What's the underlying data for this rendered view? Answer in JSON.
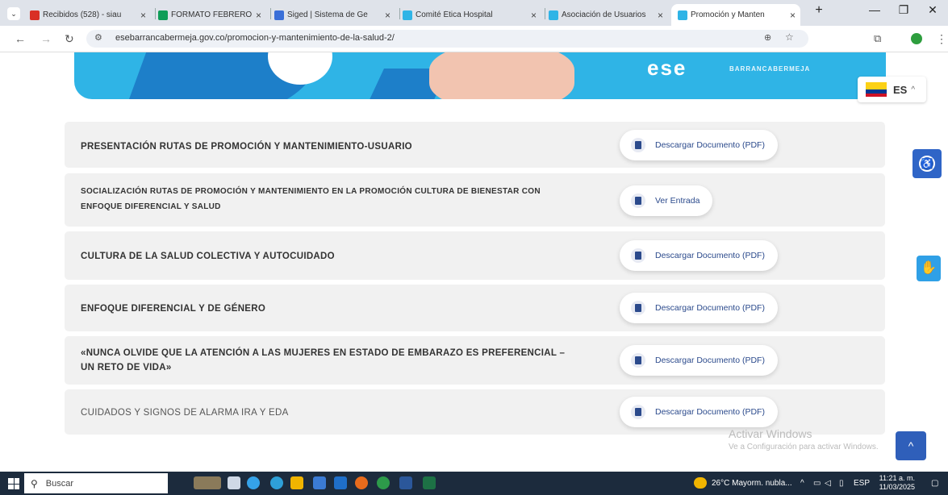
{
  "browser": {
    "tabs": [
      {
        "label": "Recibidos (528) - siau",
        "icon": "gmail-icon",
        "color": "#d93025"
      },
      {
        "label": "FORMATO FEBRERO",
        "icon": "sheets-icon",
        "color": "#0f9d58"
      },
      {
        "label": "Siged | Sistema de Ge",
        "icon": "siged-icon",
        "color": "#3a6fd8"
      },
      {
        "label": "Comité Ética Hospital",
        "icon": "ese-icon",
        "color": "#2fb4e6"
      },
      {
        "label": "Asociación de Usuarios",
        "icon": "ese-icon",
        "color": "#2fb4e6"
      },
      {
        "label": "Promoción y Manten",
        "icon": "ese-icon",
        "color": "#2fb4e6",
        "active": true
      }
    ],
    "tab_close": "×",
    "new_tab": "+",
    "tab_dropdown": "⌄",
    "window_controls": {
      "minimize": "—",
      "maximize": "❐",
      "close": "✕"
    },
    "url": "esebarrancabermeja.gov.co/promocion-y-mantenimiento-de-la-salud-2/"
  },
  "header": {
    "logo_text": "ese",
    "brand_text": "BARRANCABERMEJA",
    "language": {
      "code": "ES",
      "chevron": "^"
    }
  },
  "rows": [
    {
      "title": "PRESENTACIÓN RUTAS DE PROMOCIÓN Y MANTENIMIENTO-USUARIO",
      "button": "Descargar Documento (PDF)"
    },
    {
      "title": "SOCIALIZACIÓN RUTAS DE PROMOCIÓN Y MANTENIMIENTO EN LA PROMOCIÓN CULTURA DE BIENESTAR CON ENFOQUE DIFERENCIAL Y SALUD",
      "button": "Ver Entrada"
    },
    {
      "title": "CULTURA DE LA SALUD COLECTIVA Y AUTOCUIDADO",
      "button": "Descargar Documento (PDF)"
    },
    {
      "title": "ENFOQUE DIFERENCIAL Y DE GÉNERO",
      "button": "Descargar Documento (PDF)"
    },
    {
      "title": "«NUNCA OLVIDE QUE LA ATENCIÓN A LAS MUJERES EN ESTADO DE EMBARAZO ES PREFERENCIAL – UN RETO DE VIDA»",
      "button": "Descargar Documento (PDF)"
    },
    {
      "title": "CUIDADOS Y SIGNOS DE ALARMA IRA Y EDA",
      "button": "Descargar Documento (PDF)"
    }
  ],
  "watermark": {
    "line1": "Activar Windows",
    "line2": "Ve a Configuración para activar Windows."
  },
  "taskbar": {
    "search_placeholder": "Buscar",
    "weather": "26°C  Mayorm. nubla...",
    "language": "ESP",
    "time": "11:21 a. m.",
    "date": "11/03/2025"
  },
  "colors": {
    "banner": "#2fb4e6",
    "accent": "#2b4a8c",
    "row_bg": "#f1f1f1"
  }
}
